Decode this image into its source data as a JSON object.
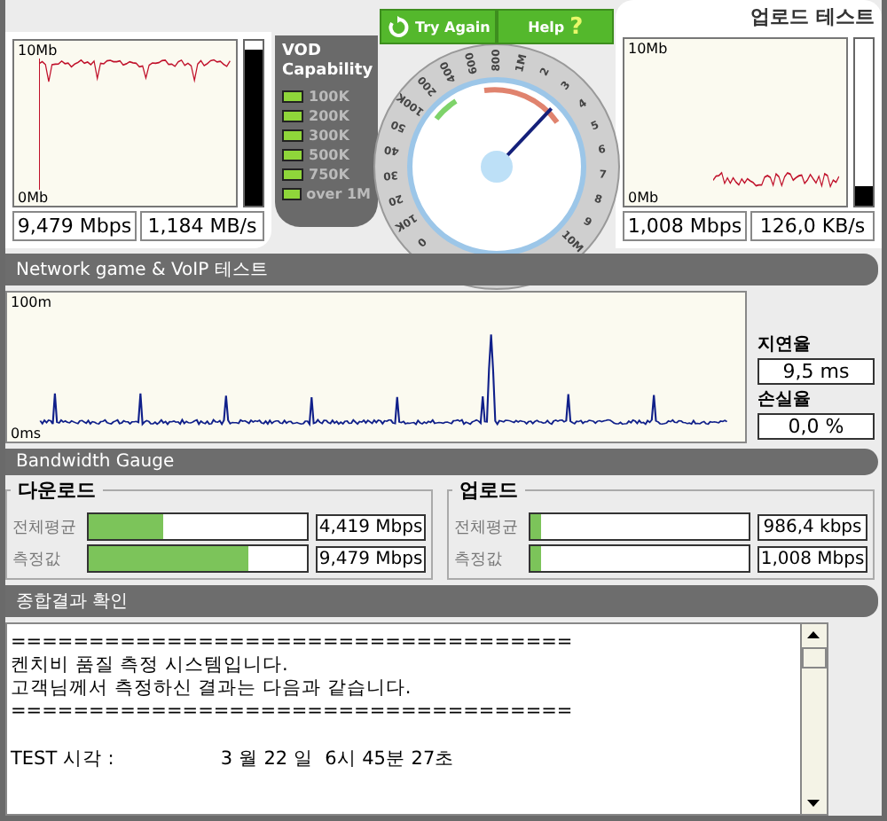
{
  "download": {
    "chart": {
      "top_label": "10Mb",
      "bottom_label": "0Mb"
    },
    "meter": {
      "level": 0.95
    },
    "rate": "9,479 Mbps",
    "throughput": "1,184 MB/s"
  },
  "vod": {
    "title": "VOD Capability",
    "items": [
      {
        "label": "100K",
        "on": true
      },
      {
        "label": "200K",
        "on": true
      },
      {
        "label": "300K",
        "on": true
      },
      {
        "label": "500K",
        "on": true
      },
      {
        "label": "750K",
        "on": true
      },
      {
        "label": "over 1M",
        "on": true
      }
    ]
  },
  "buttons": [
    {
      "label": "Try Again",
      "kind": "retry"
    },
    {
      "label": "Help",
      "kind": "help",
      "icon": "?"
    }
  ],
  "gauge": {
    "labels": [
      "0",
      "10K",
      "20",
      "30",
      "40",
      "50",
      "100K",
      "200",
      "400",
      "600",
      "800",
      "1M",
      "2",
      "3",
      "4",
      "5",
      "6",
      "7",
      "8",
      "9",
      "10M"
    ],
    "level": 0.66
  },
  "upload": {
    "title": "업로드 테스트",
    "chart": {
      "top_label": "10Mb",
      "bottom_label": "0Mb"
    },
    "meter": {
      "level": 0.12
    },
    "rate": "1,008 Mbps",
    "throughput": "126,0 KB/s"
  },
  "voip": {
    "title": "Network game & VoIP 테스트",
    "chart": {
      "top_label": "100m",
      "bottom_label": "0ms"
    },
    "latency_label": "지연율",
    "latency": "9,5 ms",
    "loss_label": "손실율",
    "loss": "0,0 %"
  },
  "bandwidth": {
    "title": "Bandwidth Gauge",
    "groups": [
      {
        "title": "다운로드",
        "rows": [
          {
            "label": "전체평균",
            "level": 0.34,
            "value": "4,419 Mbps"
          },
          {
            "label": "측정값",
            "level": 0.73,
            "value": "9,479 Mbps"
          }
        ]
      },
      {
        "title": "업로드",
        "rows": [
          {
            "label": "전체평균",
            "level": 0.05,
            "value": "986,4 kbps"
          },
          {
            "label": "측정값",
            "level": 0.05,
            "value": "1,008 Mbps"
          }
        ]
      }
    ]
  },
  "summary": {
    "title": "종합결과 확인",
    "lines": [
      "====================================",
      "켄치비 품질 측정 시스템입니다.",
      "고객님께서 측정하신 결과는 다음과 같습니다.",
      "===================================="
    ],
    "time_label": "TEST 시각 :",
    "time_value": "3 월 22 일  6시 45분 27초"
  }
}
